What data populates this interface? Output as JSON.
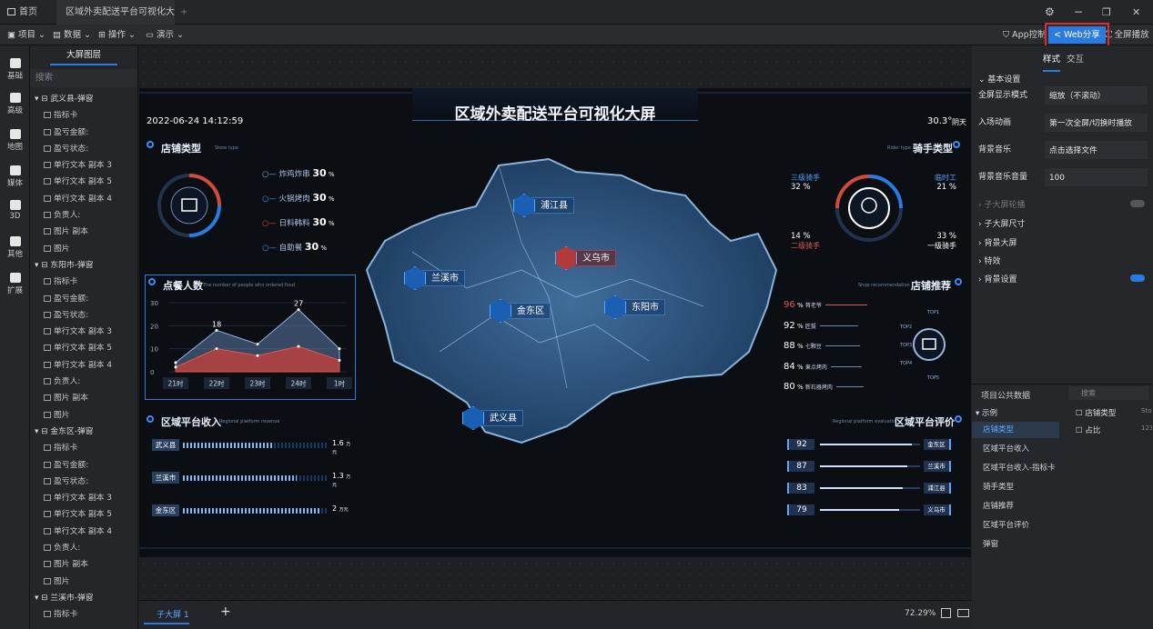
{
  "tabs": [
    {
      "label": "首页"
    },
    {
      "label": "区域外卖配送平台可视化大屏"
    }
  ],
  "window_controls": {
    "settings": "⚙",
    "minimize": "−",
    "maximize": "❐",
    "close": "✕"
  },
  "toolbar": {
    "project": "项目",
    "data": "数据",
    "operate": "操作",
    "demo": "演示",
    "app_control": "App控制",
    "web_share": "Web分享",
    "fullscreen": "全屏播放"
  },
  "left_nav": [
    {
      "label": "基础"
    },
    {
      "label": "高级"
    },
    {
      "label": "地图"
    },
    {
      "label": "媒体"
    },
    {
      "label": "3D"
    },
    {
      "label": "其他"
    },
    {
      "label": "扩展"
    }
  ],
  "layers": {
    "title": "大屏图层",
    "search_placeholder": "搜索",
    "groups": [
      {
        "name": "武义县-弹窗",
        "items": [
          "指标卡",
          "盈亏金额:",
          "盈亏状态:",
          "单行文本 副本 3",
          "单行文本 副本 5",
          "单行文本 副本 4",
          "负责人:",
          "图片 副本",
          "图片"
        ]
      },
      {
        "name": "东阳市-弹窗",
        "items": [
          "指标卡",
          "盈亏金额:",
          "盈亏状态:",
          "单行文本 副本 3",
          "单行文本 副本 5",
          "单行文本 副本 4",
          "负责人:",
          "图片 副本",
          "图片"
        ]
      },
      {
        "name": "金东区-弹窗",
        "items": [
          "指标卡",
          "盈亏金额:",
          "盈亏状态:",
          "单行文本 副本 3",
          "单行文本 副本 5",
          "单行文本 副本 4",
          "负责人:",
          "图片 副本",
          "图片"
        ]
      },
      {
        "name": "兰溪市-弹窗",
        "items": [
          "指标卡"
        ]
      }
    ]
  },
  "screen": {
    "title": "区域外卖配送平台可视化大屏",
    "datetime": "2022-06-24 14:12:59",
    "weather_temp": "30.3°",
    "weather_desc": "阴天",
    "store_type": {
      "title": "店铺类型",
      "subtitle": "Store type",
      "items": [
        {
          "label": "炸鸡炸串",
          "value": "30",
          "unit": "%"
        },
        {
          "label": "火锅烤肉",
          "value": "30",
          "unit": "%"
        },
        {
          "label": "日料韩料",
          "value": "30",
          "unit": "%"
        },
        {
          "label": "自助餐",
          "value": "30",
          "unit": "%"
        }
      ]
    },
    "rider_type": {
      "title": "骑手类型",
      "subtitle": "Rider type",
      "items": [
        {
          "label": "三级骑手",
          "value": "32",
          "unit": "%"
        },
        {
          "label": "临时工",
          "value": "21",
          "unit": "%"
        },
        {
          "label": "二级骑手",
          "value": "14",
          "unit": "%"
        },
        {
          "label": "一级骑手",
          "value": "33",
          "unit": "%"
        }
      ]
    },
    "orders": {
      "title": "点餐人数",
      "subtitle": "The number of people who ordered food"
    },
    "revenue": {
      "title": "区域平台收入",
      "subtitle": "Regional platform revenue",
      "items": [
        {
          "label": "武义县",
          "value": "1.6",
          "unit": "万元",
          "ratio": 0.62
        },
        {
          "label": "兰溪市",
          "value": "1.3",
          "unit": "万元",
          "ratio": 0.78
        },
        {
          "label": "金东区",
          "value": "2",
          "unit": "万元",
          "ratio": 0.95
        }
      ]
    },
    "recommend": {
      "title": "店铺推荐",
      "subtitle": "Shop recommendation",
      "items": [
        {
          "value": "96",
          "unit": "%",
          "name": "蒋老爷"
        },
        {
          "value": "92",
          "unit": "%",
          "name": "匠拔"
        },
        {
          "value": "88",
          "unit": "%",
          "name": "七颗豆"
        },
        {
          "value": "84",
          "unit": "%",
          "name": "東点烤肉"
        },
        {
          "value": "80",
          "unit": "%",
          "name": "新石器烤肉"
        }
      ],
      "tops": [
        "TOP1",
        "TOP2",
        "TOP3",
        "TOP4",
        "TOP5"
      ]
    },
    "evaluation": {
      "title": "区域平台评价",
      "subtitle": "Regional platform evaluatio",
      "items": [
        {
          "value": "92",
          "city": "金东区",
          "ratio": 0.92
        },
        {
          "value": "87",
          "city": "兰溪市",
          "ratio": 0.87
        },
        {
          "value": "83",
          "city": "浦江县",
          "ratio": 0.83
        },
        {
          "value": "79",
          "city": "义乌市",
          "ratio": 0.79
        }
      ]
    },
    "cities": {
      "pujiang": "浦江县",
      "yiwu": "义乌市",
      "lanxi": "兰溪市",
      "jindong": "金东区",
      "dongyang": "东阳市",
      "wuyi": "武义县"
    }
  },
  "chart_data": {
    "type": "area",
    "title": "点餐人数",
    "categories": [
      "21时",
      "22时",
      "23时",
      "24时",
      "1时"
    ],
    "ylim": [
      0,
      30
    ],
    "yticks": [
      0,
      10,
      20,
      30
    ],
    "series": [
      {
        "values": [
          4,
          18,
          12,
          27,
          10
        ],
        "color": "#5c7aa6"
      },
      {
        "values": [
          2,
          10,
          7,
          11,
          5
        ],
        "color": "#c0413b"
      }
    ],
    "labels": [
      {
        "index": 1,
        "text": "18"
      },
      {
        "index": 3,
        "text": "27"
      }
    ]
  },
  "bottom": {
    "sub_screen": "子大屏 1",
    "add": "+",
    "zoom": "72.29%"
  },
  "right_panel": {
    "tabs": [
      "样式",
      "交互"
    ],
    "basic_settings": "基本设置",
    "fields": [
      {
        "label": "全屏显示模式",
        "value": "缩放（不滚动）"
      },
      {
        "label": "入场动画",
        "value": "第一次全屏/切换时播放"
      },
      {
        "label": "背景音乐",
        "value": "点击选择文件"
      },
      {
        "label": "背景音乐音量",
        "value": "100"
      }
    ],
    "sections": [
      "子大屏轮播",
      "子大屏尺寸",
      "背景大屏",
      "特效",
      "背景设置"
    ],
    "project_data": {
      "title": "项目公共数据",
      "search": "搜索",
      "tree_root": "示例",
      "tree_items": [
        "店铺类型",
        "区域平台收入",
        "区域平台收入-指标卡",
        "骑手类型",
        "店铺推荐",
        "区域平台评价",
        "弹窗"
      ],
      "fields": [
        {
          "label": "店铺类型",
          "extra": "Sto"
        },
        {
          "label": "占比",
          "extra": "123"
        }
      ]
    }
  },
  "colors": {
    "accent": "#2a7be0",
    "highlight_red": "#e02b2b",
    "screen_bg": "#07090d",
    "panel_blue": "#3b8cff"
  }
}
